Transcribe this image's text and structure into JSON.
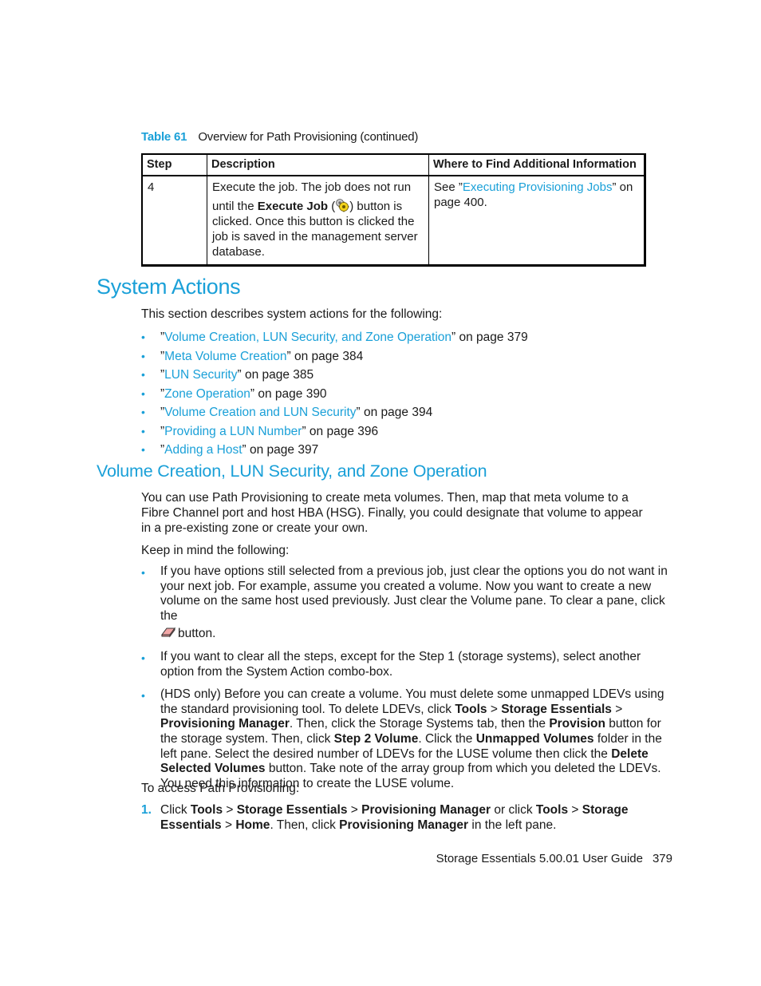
{
  "table": {
    "caption_number": "Table 61",
    "caption_title": "Overview for Path Provisioning (continued)",
    "headers": [
      "Step",
      "Description",
      "Where to Find Additional Information"
    ],
    "rows": [
      {
        "step": "4",
        "description_p1": "Execute the job. The job does not run",
        "description_p2_pre": "until the ",
        "description_p2_bold": "Execute Job",
        "description_p2_open": " (",
        "description_p2_icon": "execute-job-icon",
        "description_p2_post": ") button is clicked. Once this button is clicked the job is saved in the management server database.",
        "info_pre": "See ”",
        "info_link": "Executing Provisioning Jobs",
        "info_post": "” on page 400."
      }
    ]
  },
  "section": {
    "title": "System Actions",
    "intro": "This section describes system actions for the following:",
    "toc": [
      {
        "link": "Volume Creation, LUN Security, and Zone Operation",
        "suffix": "” on page 379"
      },
      {
        "link": "Meta Volume Creation",
        "suffix": "” on page 384"
      },
      {
        "link": "LUN Security",
        "suffix": "” on page 385"
      },
      {
        "link": "Zone Operation",
        "suffix": "” on page 390"
      },
      {
        "link": "Volume Creation and LUN Security",
        "suffix": "” on page 394"
      },
      {
        "link": "Providing a LUN Number",
        "suffix": "” on page 396"
      },
      {
        "link": "Adding a Host",
        "suffix": "” on page 397"
      }
    ],
    "open_quote": "”",
    "bullet": "•"
  },
  "subsection": {
    "title": "Volume Creation, LUN Security, and Zone Operation",
    "para1": "You can use Path Provisioning to create meta volumes. Then, map that meta volume to a Fibre Channel port and host HBA (HSG). Finally, you could designate that volume to appear in a pre-existing zone or create your own.",
    "para2": "Keep in mind the following:",
    "bullets": {
      "b1_text": "If you have options still selected from a previous job, just clear the options you do not want in your next job. For example, assume you created a volume. Now you want to create a new volume on the same host used previously. Just clear the Volume pane. To clear a pane, click the",
      "b1_icon": "eraser-icon",
      "b1_tail": "button.",
      "b2_text": "If you want to clear all the steps, except for the Step 1 (storage systems), select another option from the System Action combo-box.",
      "b3": {
        "t1": "(HDS only) Before you can create a volume. You must delete some unmapped LDEVs using the standard provisioning tool. To delete LDEVs, click ",
        "k1": "Tools",
        "t2": " > ",
        "k2": "Storage Essentials",
        "t3": " > ",
        "k3": "Provisioning Manager",
        "t4": ". Then, click the Storage Systems tab, then the ",
        "k4": "Provision",
        "t5": " button for the storage system. Then, click ",
        "k5": "Step 2 Volume",
        "t6": ". Click the ",
        "k6": "Unmapped Volumes",
        "t7": " folder in the left pane. Select the desired number of LDEVs for the LUSE volume then click the ",
        "k7": "Delete Selected Volumes",
        "t8": " button. Take note of the array group from which you deleted the LDEVs. You need this information to create the LUSE volume."
      }
    },
    "para3": "To access Path Provisioning:",
    "steps": [
      {
        "num": "1.",
        "t1": "Click ",
        "k1": "Tools",
        "t2": " > ",
        "k2": "Storage Essentials",
        "t3": " > ",
        "k3": "Provisioning Manager",
        "t4": " or click ",
        "k4": "Tools",
        "t5": " > ",
        "k5": "Storage Essentials",
        "t6": " > ",
        "k6": "Home",
        "t7": ". Then, click ",
        "k7": "Provisioning Manager",
        "t8": " in the left pane."
      }
    ]
  },
  "footer": {
    "guide_title": "Storage Essentials 5.00.01 User Guide",
    "page_number": "379"
  }
}
